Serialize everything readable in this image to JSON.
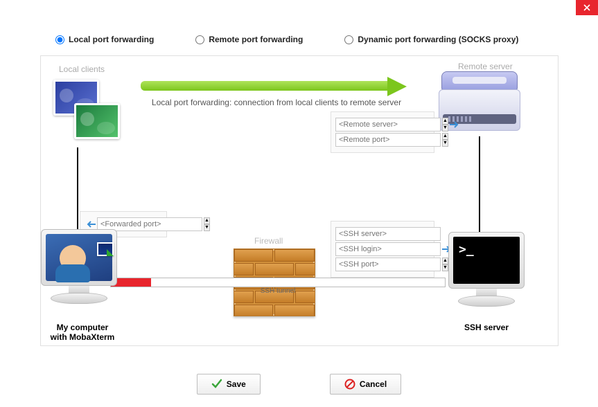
{
  "radios": {
    "local": "Local port forwarding",
    "remote": "Remote port forwarding",
    "dynamic": "Dynamic port forwarding (SOCKS proxy)"
  },
  "labels": {
    "local_clients": "Local clients",
    "remote_server": "Remote server",
    "firewall": "Firewall",
    "arrow_desc": "Local port forwarding: connection from local clients to remote server",
    "mycomputer_line1": "My computer",
    "mycomputer_line2": "with MobaXterm",
    "ssh_server": "SSH server",
    "ssh_tunnel": "SSH tunnel",
    "prompt": ">_"
  },
  "placeholders": {
    "remote_server": "<Remote server>",
    "remote_port": "<Remote port>",
    "forwarded_port": "<Forwarded port>",
    "ssh_server": "<SSH server>",
    "ssh_login": "<SSH login>",
    "ssh_port": "<SSH port>"
  },
  "buttons": {
    "save": "Save",
    "cancel": "Cancel"
  }
}
